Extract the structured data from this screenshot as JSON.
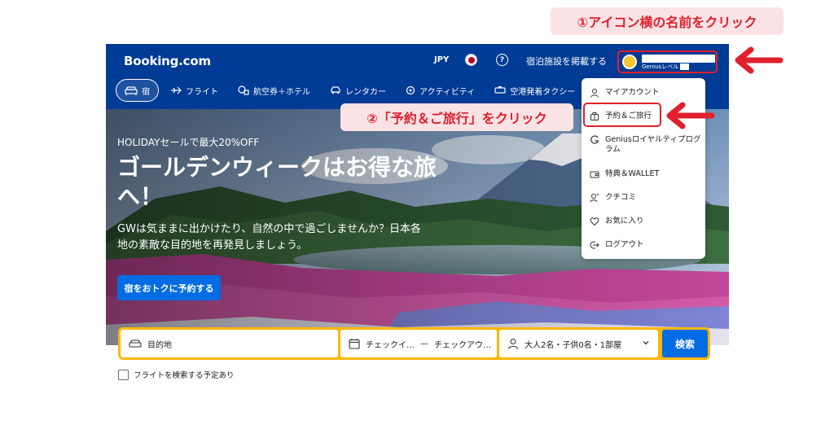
{
  "annotations": {
    "step1": "①アイコン横の名前をクリック",
    "step2": "②「予約＆ご旅行」をクリック",
    "color": "#e0202c"
  },
  "header": {
    "logo": "Booking.com",
    "currency": "JPY",
    "flag_icon": "japan-flag-icon",
    "help_icon": "question-icon",
    "list_property": "宿泊施設を掲載する",
    "account_level": "Geniusレベル",
    "brand_color": "#003b95"
  },
  "nav": {
    "items": [
      {
        "label": "宿",
        "icon": "bed-icon",
        "active": true
      },
      {
        "label": "フライト",
        "icon": "plane-icon"
      },
      {
        "label": "航空券＋ホテル",
        "icon": "plane-hotel-icon"
      },
      {
        "label": "レンタカー",
        "icon": "car-icon"
      },
      {
        "label": "アクティビティ",
        "icon": "attraction-icon"
      },
      {
        "label": "空港発着タクシー",
        "icon": "taxi-icon"
      }
    ]
  },
  "hero": {
    "sale": "HOLIDAYセールで最大20%OFF",
    "title": "ゴールデンウィークはお得な旅へ！",
    "subtitle": "GWは気ままに出かけたり、自然の中で過ごしませんか？日本各地の素敵な目的地を再発見しましょう。",
    "button": "宿をおトクに予約する"
  },
  "account_menu": {
    "items": [
      {
        "label": "マイアカウント",
        "icon": "person-icon"
      },
      {
        "label": "予約＆ご旅行",
        "icon": "luggage-icon"
      },
      {
        "label": "Geniusロイヤルティプログラム",
        "icon": "genius-icon"
      },
      {
        "label": "特典＆WALLET",
        "icon": "wallet-icon"
      },
      {
        "label": "クチコミ",
        "icon": "review-icon"
      },
      {
        "label": "お気に入り",
        "icon": "heart-icon"
      },
      {
        "label": "ログアウト",
        "icon": "logout-icon"
      }
    ]
  },
  "search": {
    "destination_placeholder": "目的地",
    "checkin": "チェックイ…",
    "separator": "—",
    "checkout": "チェックアウ…",
    "guests": "大人2名・子供0名・1部屋",
    "button": "検索",
    "flight_checkbox": "フライトを検索する予定あり"
  }
}
